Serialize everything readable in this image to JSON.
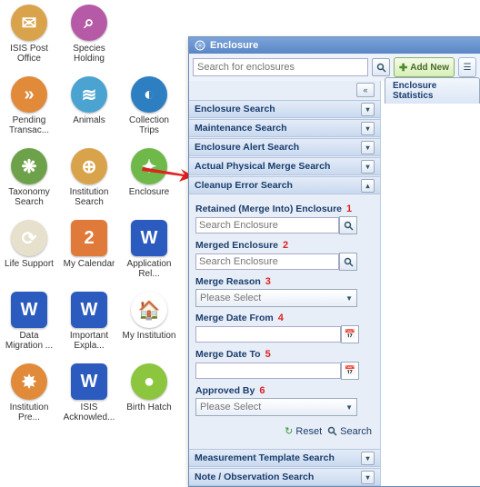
{
  "desktop": {
    "icons": [
      {
        "label": "ISIS Post Office",
        "bg": "#d9a34b",
        "glyph": "✉",
        "shape": "circle"
      },
      {
        "label": "Species Holding",
        "bg": "#b65aa8",
        "glyph": "⌕",
        "shape": "circle"
      },
      null,
      {
        "label": "Pending Transac...",
        "bg": "#e08a3a",
        "glyph": "»",
        "shape": "circle"
      },
      {
        "label": "Animals",
        "bg": "#4aa3d0",
        "glyph": "≋",
        "shape": "circle"
      },
      {
        "label": "Collection Trips",
        "bg": "#2e7fc2",
        "glyph": "◐",
        "shape": "circle"
      },
      {
        "label": "Taxonomy Search",
        "bg": "#6ea24a",
        "glyph": "❋",
        "shape": "circle"
      },
      {
        "label": "Institution Search",
        "bg": "#d9a34b",
        "glyph": "⊕",
        "shape": "circle"
      },
      {
        "label": "Enclosure",
        "bg": "#6fb84a",
        "glyph": "✦",
        "shape": "circle"
      },
      {
        "label": "Life Support",
        "bg": "#e6e0cc",
        "glyph": "⟳",
        "shape": "circle"
      },
      {
        "label": "My Calendar",
        "bg": "#e07a3a",
        "glyph": "2",
        "shape": "square"
      },
      {
        "label": "Application Rel...",
        "bg": "#2b5bbf",
        "glyph": "W",
        "shape": "square"
      },
      {
        "label": "Data Migration ...",
        "bg": "#2b5bbf",
        "glyph": "W",
        "shape": "square"
      },
      {
        "label": "Important Expla...",
        "bg": "#2b5bbf",
        "glyph": "W",
        "shape": "square"
      },
      {
        "label": "My Institution",
        "bg": "#ffffff",
        "glyph": "🏠",
        "shape": "circle"
      },
      {
        "label": "Institution Pre...",
        "bg": "#e08a3a",
        "glyph": "✸",
        "shape": "circle"
      },
      {
        "label": "ISIS Acknowled...",
        "bg": "#2b5bbf",
        "glyph": "W",
        "shape": "square"
      },
      {
        "label": "Birth Hatch",
        "bg": "#8cc63f",
        "glyph": "●",
        "shape": "circle"
      }
    ]
  },
  "window": {
    "title": "Enclosure",
    "search_placeholder": "Search for enclosures",
    "add_new": "Add New",
    "stats_tab": "Enclosure Statistics",
    "accordions": {
      "enclosure_search": "Enclosure Search",
      "maintenance_search": "Maintenance Search",
      "enclosure_alert_search": "Enclosure Alert Search",
      "actual_physical_merge": "Actual Physical Merge Search",
      "cleanup_error_search": "Cleanup Error Search",
      "measurement_template": "Measurement Template Search",
      "note_observation": "Note / Observation Search"
    },
    "form": {
      "retained_label": "Retained (Merge Into) Enclosure",
      "merged_label": "Merged Enclosure",
      "merge_reason_label": "Merge Reason",
      "merge_from_label": "Merge Date From",
      "merge_to_label": "Merge Date To",
      "approved_by_label": "Approved By",
      "search_enclosure_placeholder": "Search Enclosure",
      "please_select": "Please Select",
      "nums": {
        "n1": "1",
        "n2": "2",
        "n3": "3",
        "n4": "4",
        "n5": "5",
        "n6": "6"
      }
    },
    "buttons": {
      "reset": "Reset",
      "search": "Search"
    }
  }
}
